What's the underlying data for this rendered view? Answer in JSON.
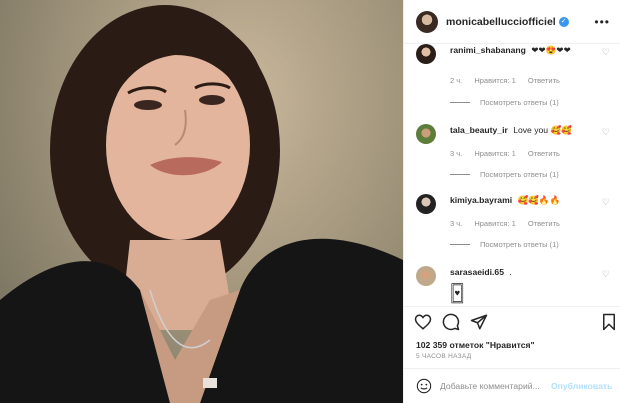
{
  "post": {
    "username": "monicabellucciofficiel",
    "verified_mark": "✓",
    "more_glyph": "•••"
  },
  "comments": [
    {
      "username": "ranimi_shabanang",
      "text": "❤❤😍❤❤",
      "time": "2 ч.",
      "likes": "Нравится: 1",
      "reply": "Ответить",
      "replies": "Посмотреть ответы (1)"
    },
    {
      "username": "tala_beauty_ir",
      "text": "Love you 🥰🥰",
      "time": "3 ч.",
      "likes": "Нравится: 1",
      "reply": "Ответить",
      "replies": "Посмотреть ответы (1)"
    },
    {
      "username": "kimiya.bayrami",
      "text": "🥰🥰🔥🔥",
      "time": "3 ч.",
      "likes": "Нравится: 1",
      "reply": "Ответить",
      "replies": "Посмотреть ответы (1)"
    },
    {
      "username": "sarasaeidi.65",
      "text": ".",
      "sticker": "╔═╗\n║♥║\n╚═╝"
    }
  ],
  "likes_count": "102 359 отметок \"Нравится\"",
  "posted_ago": "5 часов назад",
  "add_comment": {
    "placeholder": "Добавьте комментарий...",
    "publish_label": "Опубликовать"
  },
  "icons": {
    "like": "heart-outline-icon",
    "comment": "comment-bubble-icon",
    "share": "paper-plane-icon",
    "save": "bookmark-icon",
    "emoji": "smiley-icon"
  }
}
